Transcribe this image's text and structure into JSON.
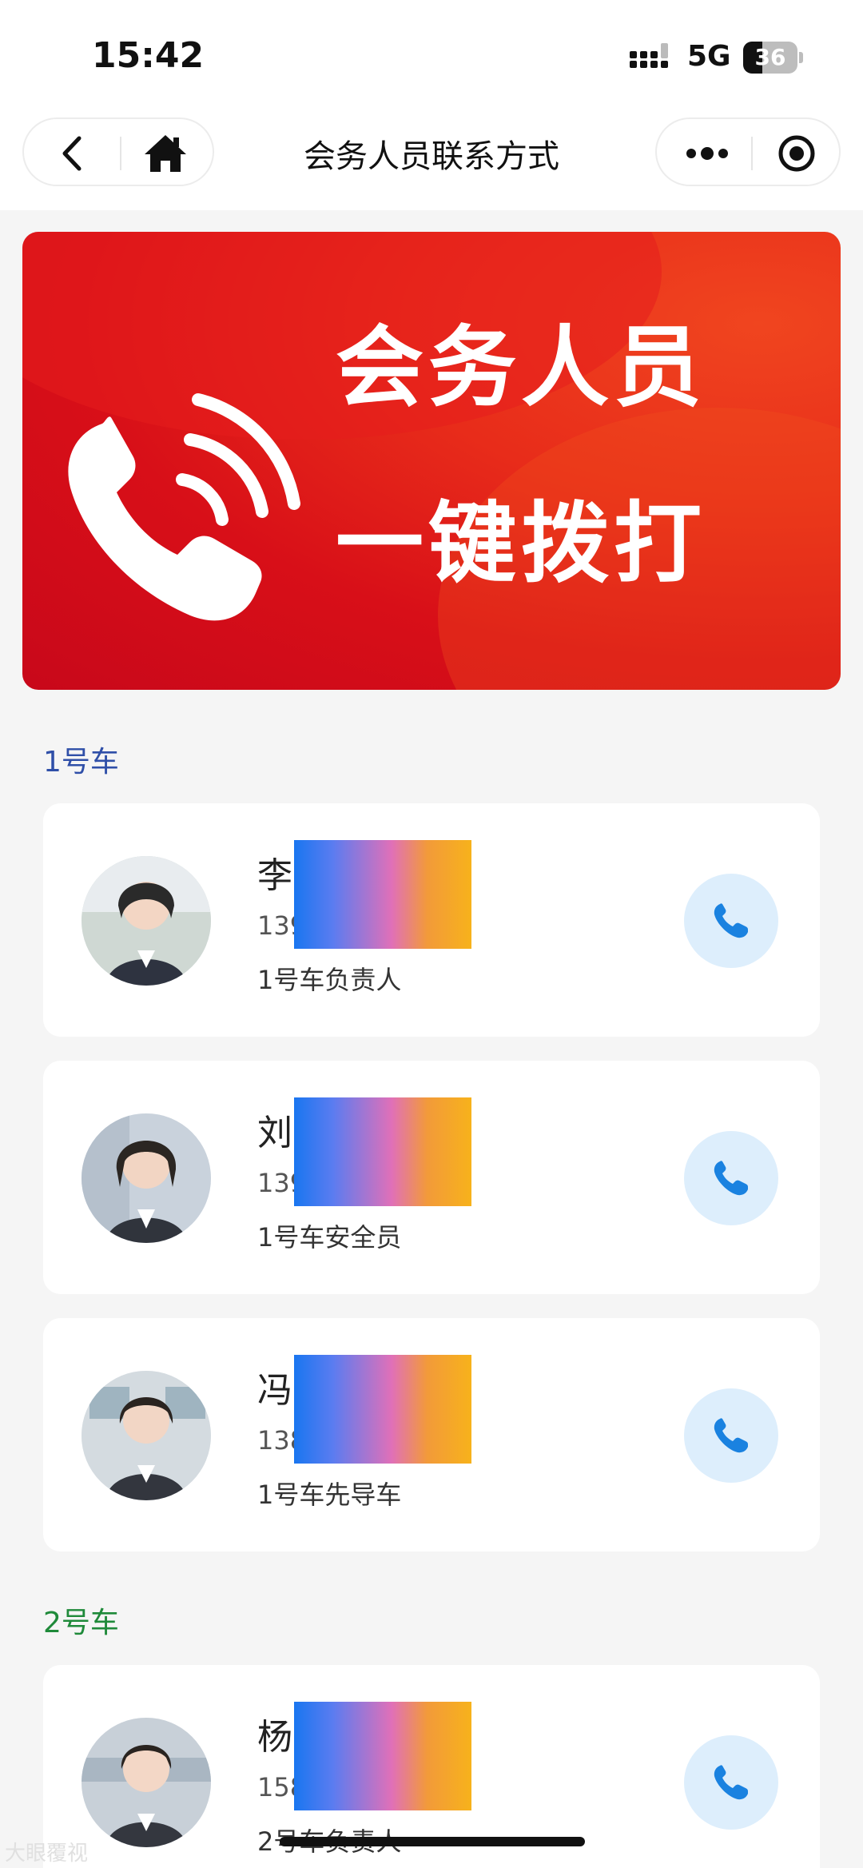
{
  "status_bar": {
    "time": "15:42",
    "network": "5G",
    "battery": "36",
    "battery_level": 0.36
  },
  "nav": {
    "title": "会务人员联系方式",
    "icons": {
      "back": "chevron-left-icon",
      "home": "home-icon",
      "more": "more-dots-icon",
      "close": "target-circle-icon"
    }
  },
  "banner": {
    "line1": "会务人员",
    "line2": "一键拨打",
    "icon": "phone-ringing-icon",
    "colors": {
      "background": "#d80f18",
      "text": "#ffffff"
    }
  },
  "sections": [
    {
      "title": "1号车",
      "title_color": "#2f4fa8",
      "contacts": [
        {
          "name": "李",
          "phone": "139",
          "role": "1号车负责人"
        },
        {
          "name": "刘",
          "phone": "139",
          "role": "1号车安全员"
        },
        {
          "name": "冯",
          "phone": "138",
          "role": "1号车先导车"
        }
      ]
    },
    {
      "title": "2号车",
      "title_color": "#1f8a3a",
      "contacts": [
        {
          "name": "杨",
          "phone": "158",
          "role": "2号车负责人"
        }
      ]
    }
  ],
  "watermark": "大眼覆视",
  "accent": {
    "call_icon": "#1a82e0",
    "call_bg": "#ddeefc"
  }
}
